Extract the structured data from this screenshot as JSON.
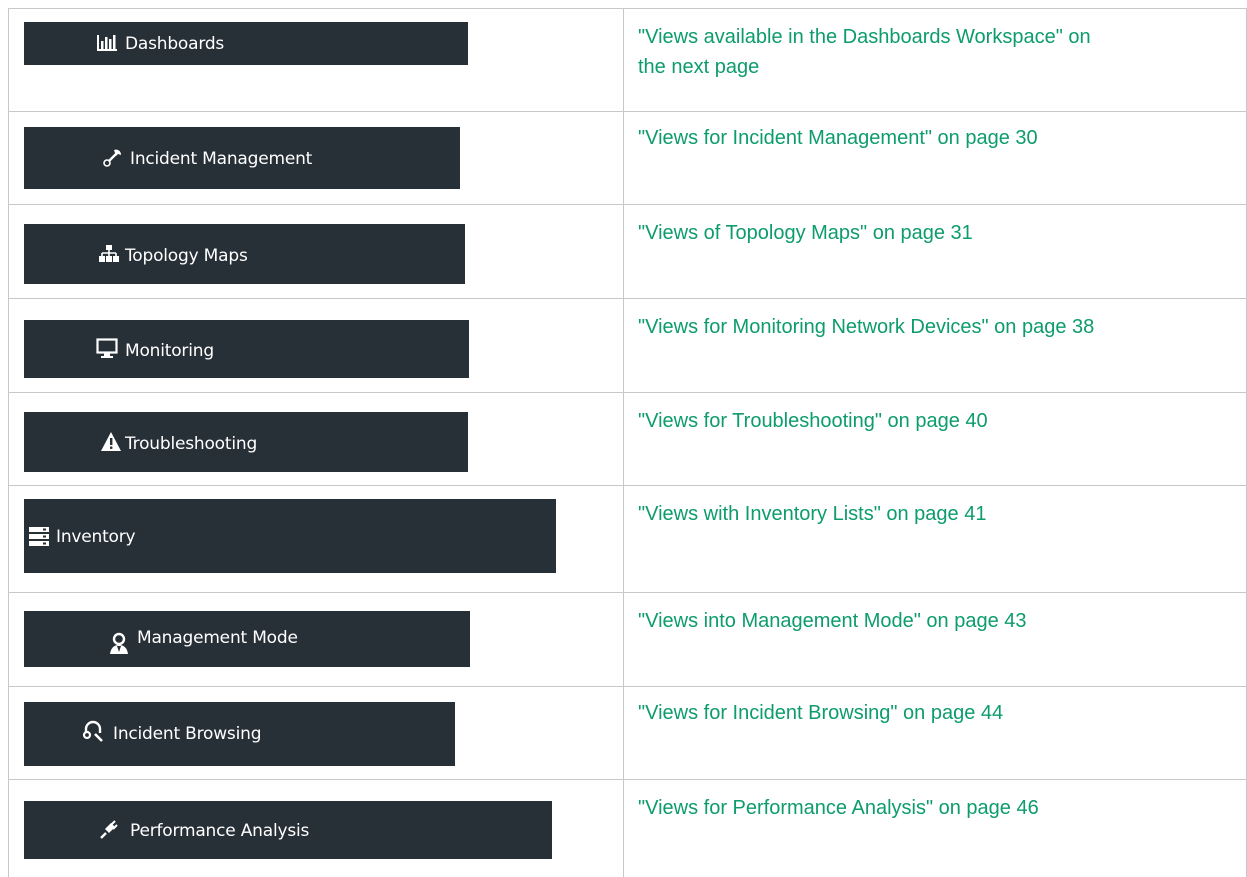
{
  "rows": [
    {
      "label": "Dashboards",
      "icon": "bar-chart-icon",
      "link": "\"Views available in the Dashboards Workspace\" on",
      "link_line2": "the next page"
    },
    {
      "label": "Incident Management",
      "icon": "wrench-icon",
      "link": "\"Views for Incident Management\" on page 30"
    },
    {
      "label": "Topology Maps",
      "icon": "sitemap-icon",
      "link": "\"Views of Topology Maps\" on page 31"
    },
    {
      "label": "Monitoring",
      "icon": "desktop-icon",
      "link": "\"Views for Monitoring Network Devices\" on page 38"
    },
    {
      "label": "Troubleshooting",
      "icon": "warning-icon",
      "link": "\"Views for Troubleshooting\" on page 40"
    },
    {
      "label": "Inventory",
      "icon": "server-icon",
      "link": "\"Views with Inventory Lists\" on page 41"
    },
    {
      "label": "Management Mode",
      "icon": "user-icon",
      "link": "\"Views into Management Mode\" on page 43"
    },
    {
      "label": "Incident Browsing",
      "icon": "headset-icon",
      "link": "\"Views for Incident Browsing\" on page 44"
    },
    {
      "label": "Performance Analysis",
      "icon": "plug-icon",
      "link": "\"Views for Performance Analysis\" on page 46"
    }
  ],
  "colors": {
    "bar": "#272f37",
    "link": "#0d9c6b",
    "grid": "#c8c8c8",
    "icon": "#ffffff"
  }
}
